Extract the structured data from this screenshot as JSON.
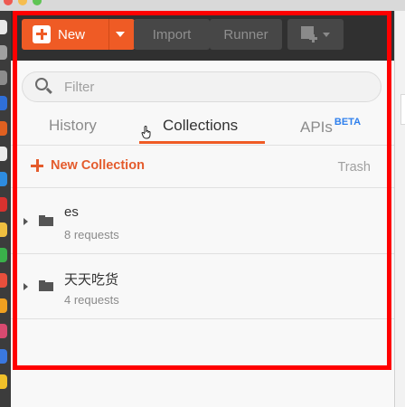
{
  "toolbar": {
    "new_label": "New",
    "import_label": "Import",
    "runner_label": "Runner"
  },
  "sidebar": {
    "filter_placeholder": "Filter",
    "tabs": [
      {
        "label": "History"
      },
      {
        "label": "Collections",
        "active": true
      },
      {
        "label": "APIs",
        "badge": "BETA"
      }
    ],
    "new_collection_label": "New Collection",
    "trash_label": "Trash",
    "collections": [
      {
        "name": "es",
        "count": "8 requests"
      },
      {
        "name": "天天吃货",
        "count": "4 requests"
      }
    ]
  },
  "colors": {
    "accent": "#ef5b25",
    "toolbar_bg": "#303030",
    "beta": "#2f80ed",
    "highlight": "#ff0000"
  },
  "icons": [
    "plus-icon",
    "caret-down-icon",
    "new-window-icon",
    "search-icon",
    "pointer-cursor-icon",
    "caret-right-icon",
    "folder-icon"
  ]
}
